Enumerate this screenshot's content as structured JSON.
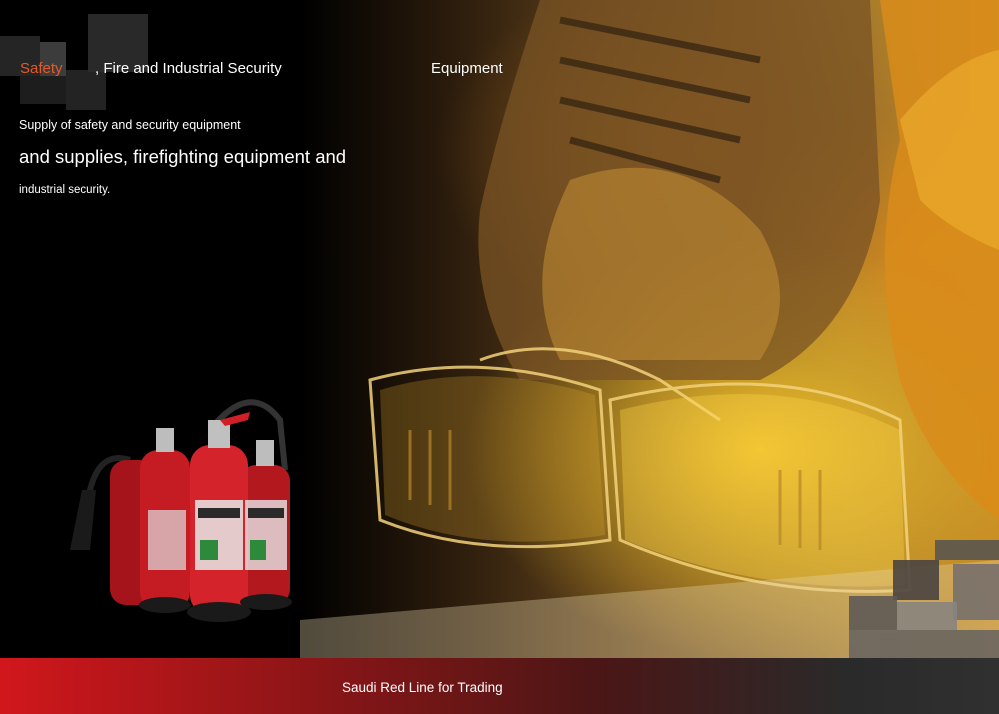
{
  "title": {
    "word1": "Safety",
    "word2": ", Fire and Industrial Security",
    "word3": "Equipment"
  },
  "description": {
    "line1": "Supply of safety and security equipment",
    "line2": "and supplies, firefighting equipment and",
    "line3": "industrial security."
  },
  "footer": {
    "company": "Saudi Red Line for Trading"
  },
  "colors": {
    "accent": "#e35a2a",
    "footer_red": "#d1171c"
  },
  "images": {
    "background": "safety-boot-goggles-hardhat-photo",
    "product": "fire-extinguishers-group"
  }
}
